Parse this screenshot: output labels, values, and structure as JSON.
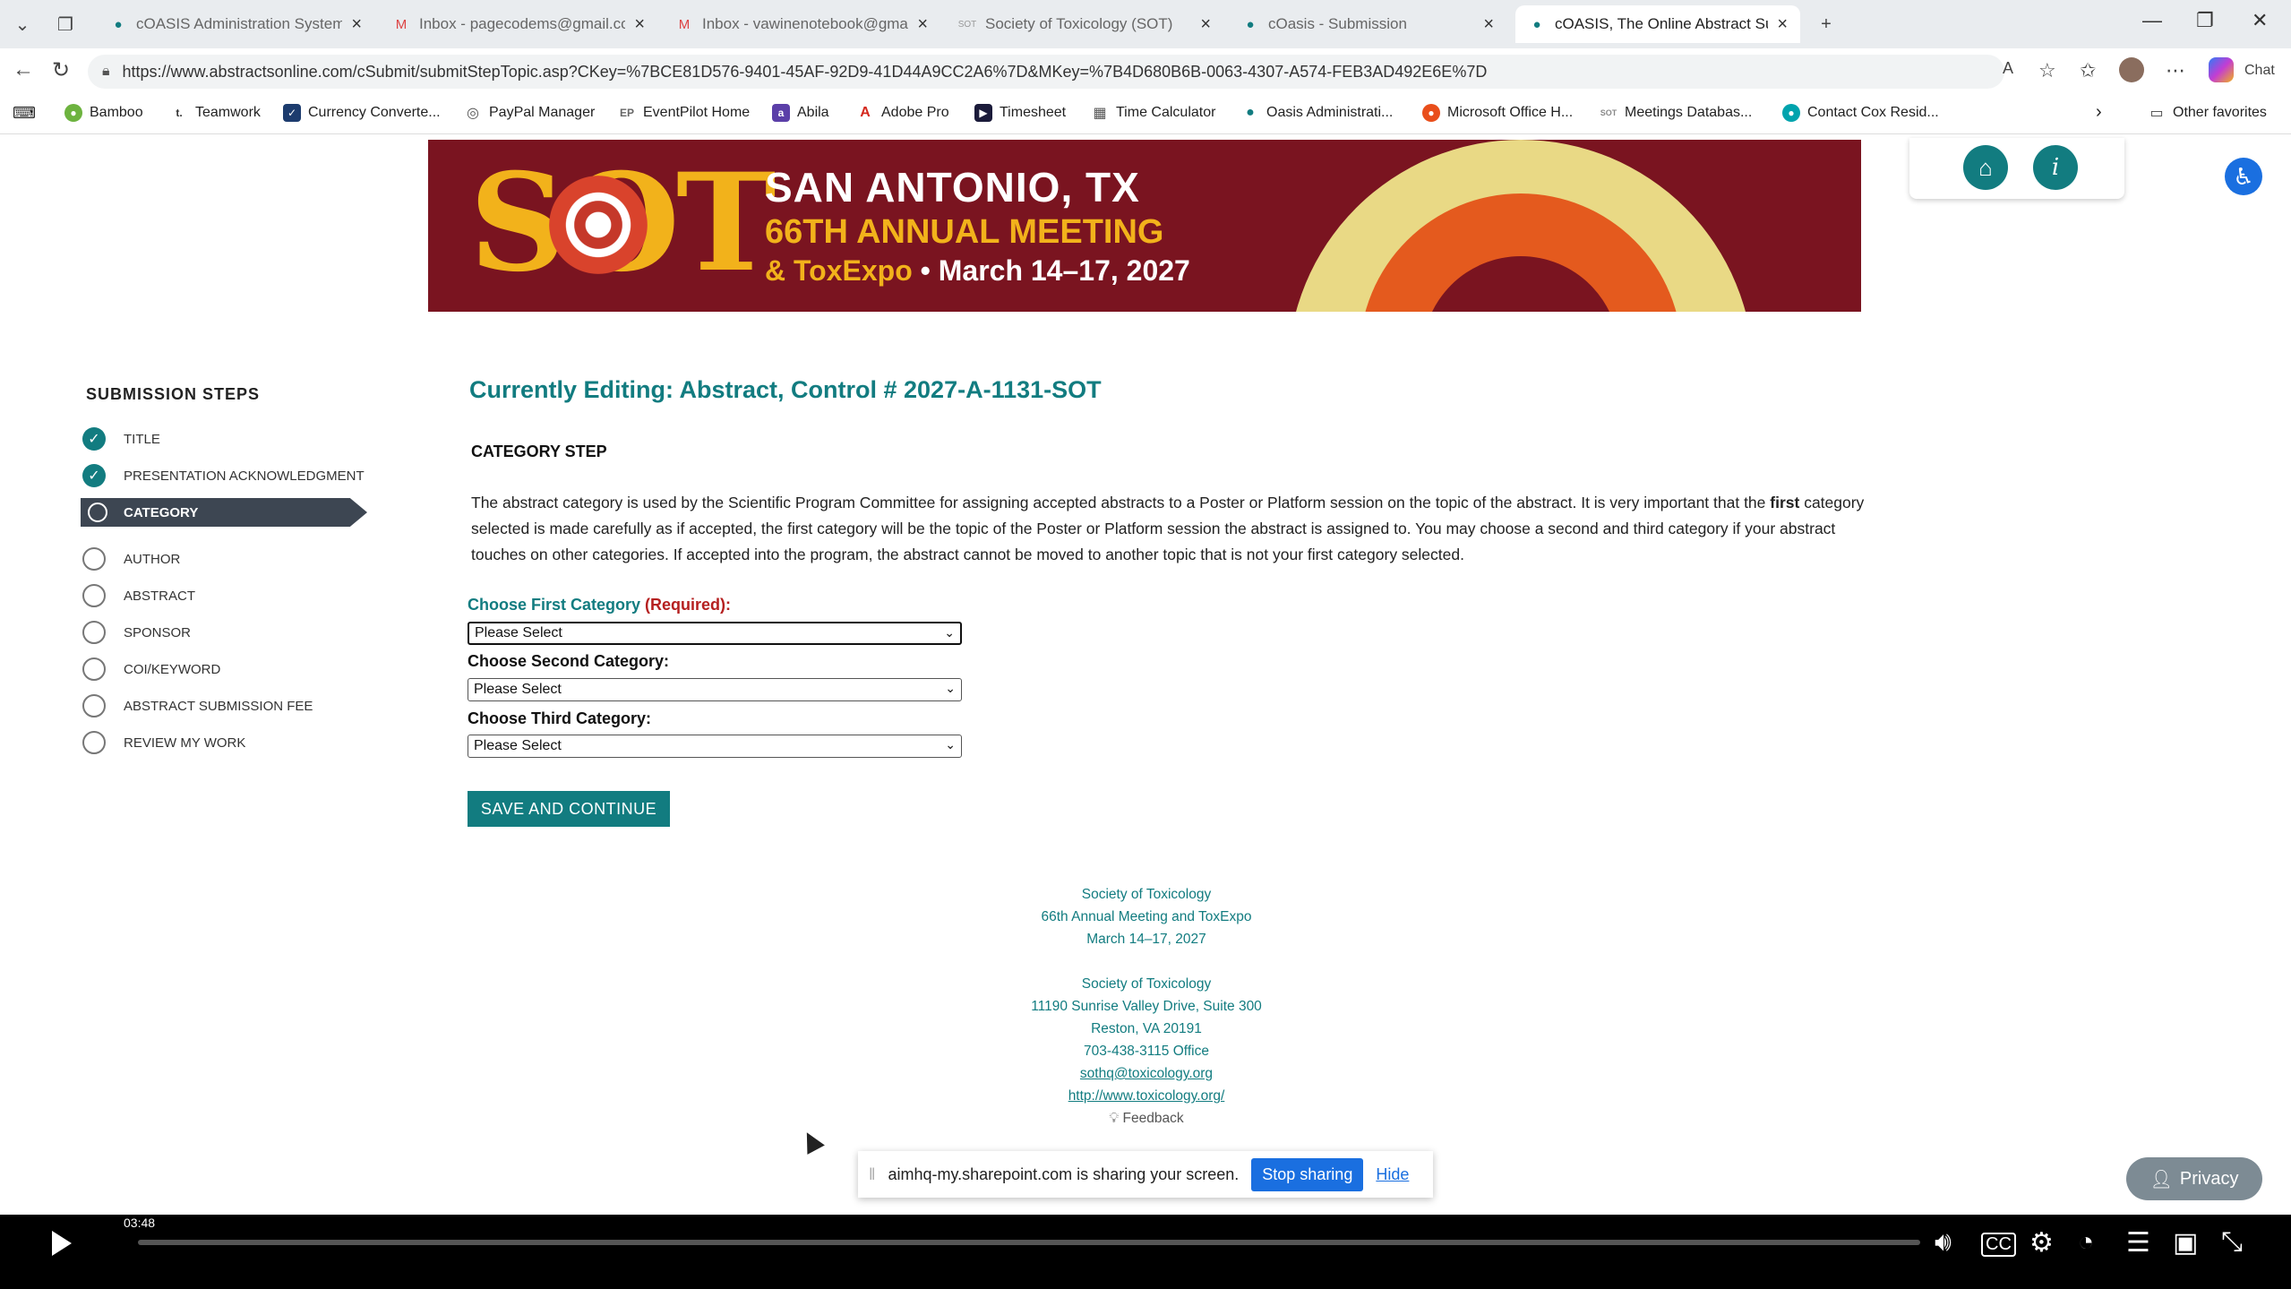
{
  "browser": {
    "tabs": [
      {
        "title": "cOASIS Administration System",
        "icon": "oasis-icon"
      },
      {
        "title": "Inbox - pagecodems@gmail.com",
        "icon": "gmail-icon"
      },
      {
        "title": "Inbox - vawinenotebook@gmail.c",
        "icon": "gmail-icon"
      },
      {
        "title": "Society of Toxicology (SOT)",
        "icon": "sot-icon"
      },
      {
        "title": "cOasis - Submission",
        "icon": "oasis-icon"
      },
      {
        "title": "cOASIS, The Online Abstract Subm",
        "icon": "oasis-icon",
        "active": true
      }
    ],
    "url": "https://www.abstractsonline.com/cSubmit/submitStepTopic.asp?CKey=%7BCE81D576-9401-45AF-92D9-41D44A9CC2A6%7D&MKey=%7B4D680B6B-0063-4307-A574-FEB3AD492E6E%7D",
    "chat_label": "Chat",
    "favorites": [
      {
        "label": "Bamboo",
        "color": "#6db33f"
      },
      {
        "label": "Teamwork",
        "color": "#333333"
      },
      {
        "label": "Currency Converte...",
        "color": "#1d3c6e"
      },
      {
        "label": "PayPal Manager",
        "color": "#555555"
      },
      {
        "label": "EventPilot Home",
        "color": "#666666"
      },
      {
        "label": "Abila",
        "color": "#5b3fa8"
      },
      {
        "label": "Adobe Pro",
        "color": "#d4271c"
      },
      {
        "label": "Timesheet",
        "color": "#1b1b3a"
      },
      {
        "label": "Time Calculator",
        "color": "#555555"
      },
      {
        "label": "Oasis Administrati...",
        "color": "#127c80"
      },
      {
        "label": "Microsoft Office H...",
        "color": "#e94e1b"
      },
      {
        "label": "Meetings Databas...",
        "color": "#888888"
      },
      {
        "label": "Contact Cox Resid...",
        "color": "#00a3ad"
      }
    ],
    "other_favorites": "Other favorites"
  },
  "banner": {
    "logo": "SOT",
    "line1": "SAN ANTONIO, TX",
    "line2": "66TH ANNUAL MEETING",
    "line3a": "& ToxExpo",
    "line3b": "• March 14–17, 2027"
  },
  "sidebar": {
    "title": "SUBMISSION STEPS",
    "steps": [
      {
        "label": "TITLE",
        "state": "done"
      },
      {
        "label": "PRESENTATION ACKNOWLEDGMENT",
        "state": "done"
      },
      {
        "label": "CATEGORY",
        "state": "active"
      },
      {
        "label": "AUTHOR",
        "state": "todo"
      },
      {
        "label": "ABSTRACT",
        "state": "todo"
      },
      {
        "label": "SPONSOR",
        "state": "todo"
      },
      {
        "label": "COI/KEYWORD",
        "state": "todo"
      },
      {
        "label": "ABSTRACT SUBMISSION FEE",
        "state": "todo"
      },
      {
        "label": "REVIEW MY WORK",
        "state": "todo"
      }
    ]
  },
  "main": {
    "editing_title": "Currently Editing: Abstract,  Control # 2027-A-1131-SOT",
    "step_heading": "CATEGORY STEP",
    "intro_part1": "The abstract category is used by the Scientific Program Committee for assigning accepted abstracts to a Poster or Platform session on the topic of the abstract. It is very important that the ",
    "intro_bold": "first",
    "intro_part2": " category selected is made carefully as if accepted, the first category will be the topic of the Poster or Platform session the abstract is assigned to. You may choose a second and third category if your abstract touches on other categories. If accepted into the program, the abstract cannot be moved to another topic that is not your first category selected.",
    "first_label": "Choose First Category ",
    "first_required": "(Required):",
    "second_label": "Choose Second Category:",
    "third_label": "Choose Third Category:",
    "select_value": "Please Select",
    "save_button": "SAVE AND CONTINUE"
  },
  "footer": {
    "org1": "Society of Toxicology",
    "meeting": "66th Annual Meeting and ToxExpo",
    "dates": "March 14–17, 2027",
    "org2": "Society of Toxicology",
    "address1": "11190 Sunrise Valley Drive, Suite 300",
    "address2": "Reston, VA 20191",
    "phone": "703-438-3115 Office",
    "email": "sothq@toxicology.org",
    "website": "http://www.toxicology.org/",
    "feedback": "Feedback"
  },
  "share_bar": {
    "message": "aimhq-my.sharepoint.com is sharing your screen.",
    "stop": "Stop sharing",
    "hide": "Hide"
  },
  "privacy_label": "Privacy",
  "player": {
    "time": "03:48",
    "progress_fraction": 0.0
  }
}
